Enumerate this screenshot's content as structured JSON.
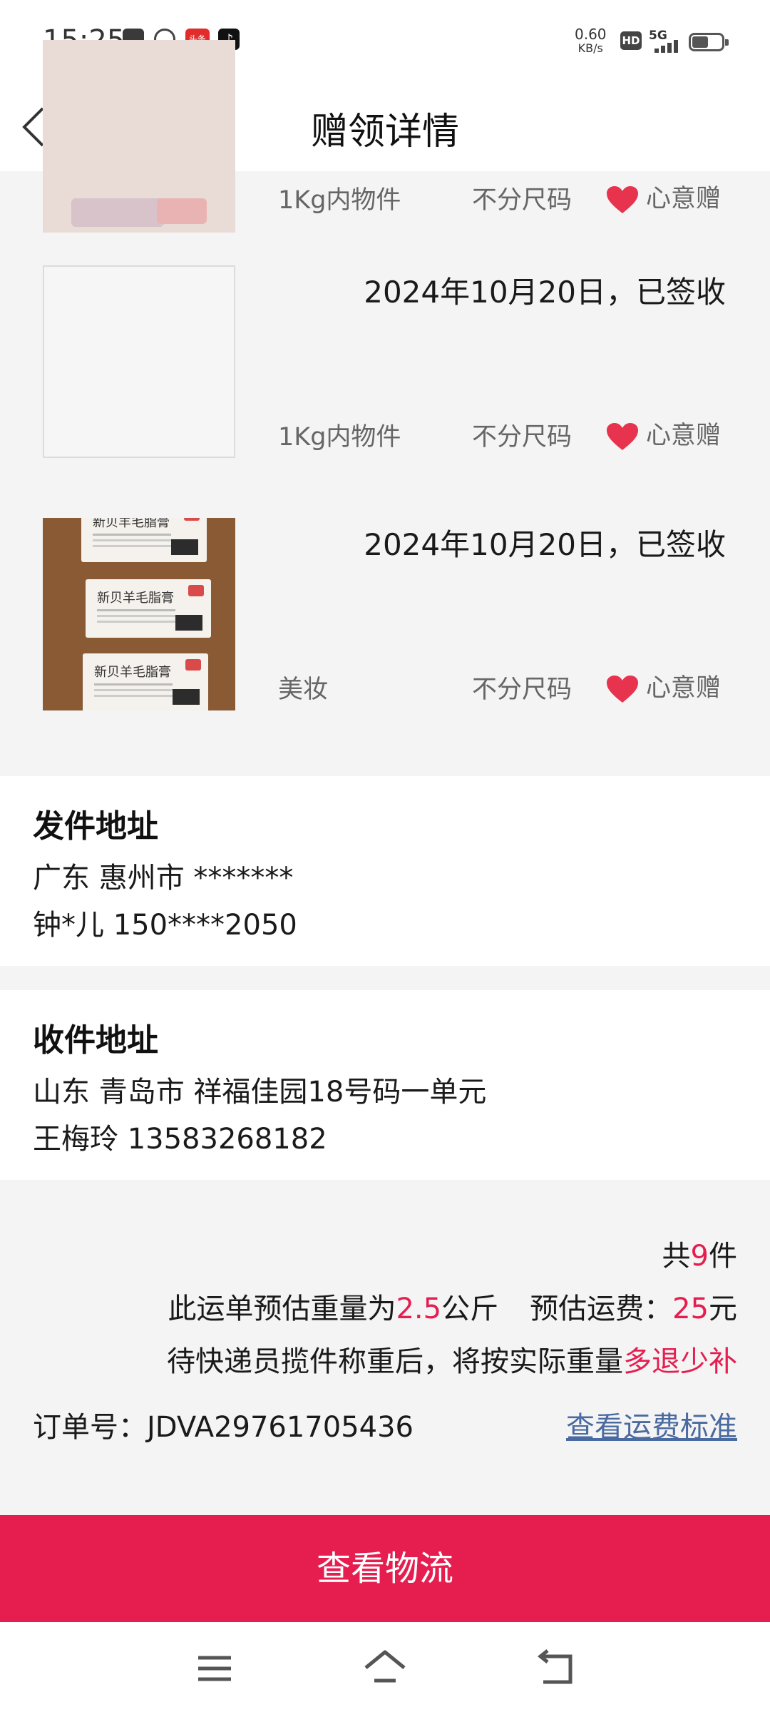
{
  "status_bar": {
    "time": "15:25",
    "net_speed_value": "0.60",
    "net_speed_unit": "KB/s",
    "hd_label": "HD",
    "network_label": "5G",
    "app_badge_label": "头条"
  },
  "nav": {
    "title": "赠领详情"
  },
  "items": [
    {
      "date": "",
      "category": "1Kg内物件",
      "size": "不分尺码",
      "gift_type": "心意赠"
    },
    {
      "date": "2024年10月20日，已签收",
      "category": "1Kg内物件",
      "size": "不分尺码",
      "gift_type": "心意赠"
    },
    {
      "date": "2024年10月20日，已签收",
      "category": "美妆",
      "size": "不分尺码",
      "gift_type": "心意赠",
      "photo_label": "新贝羊毛脂膏"
    }
  ],
  "sender": {
    "heading": "发件地址",
    "region": "广东 惠州市 *******",
    "contact": "钟*儿 150****2050"
  },
  "receiver": {
    "heading": "收件地址",
    "region": "山东 青岛市 祥福佳园18号码一单元",
    "contact": "王梅玲 13583268182"
  },
  "summary": {
    "count_prefix": "共",
    "count": "9",
    "count_suffix": "件",
    "weight_prefix": "此运单预估重量为",
    "weight": "2.5",
    "weight_unit": "公斤",
    "fee_prefix": "预估运费：",
    "fee": "25",
    "fee_unit": "元",
    "note_prefix": "待快递员揽件称重后，将按实际重量",
    "note_accent": "多退少补",
    "order_label": "订单号：",
    "order_number": "JDVA29761705436",
    "fee_standard_link": "查看运费标准"
  },
  "actions": {
    "logistics_button": "查看物流"
  },
  "colors": {
    "accent": "#e61e50",
    "link": "#4a6aa0",
    "heart": "#e8334f"
  }
}
